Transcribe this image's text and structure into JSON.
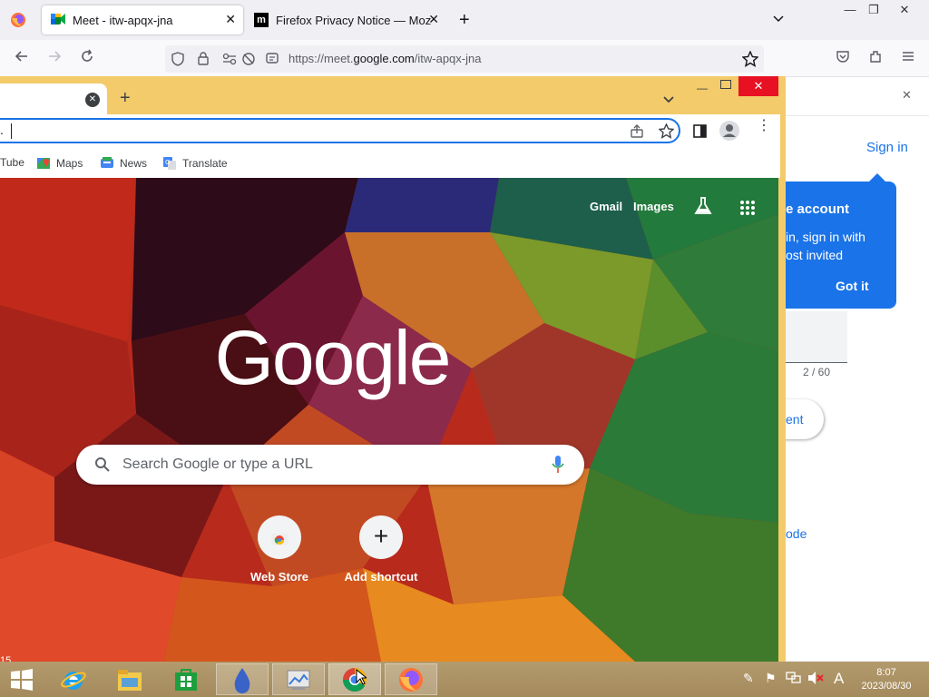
{
  "firefox": {
    "tabs": [
      {
        "title": "Meet - itw-apqx-jna",
        "active": true
      },
      {
        "title": "Firefox Privacy Notice — Mozill",
        "active": false
      }
    ],
    "url_prefix": "https://meet.",
    "url_domain": "google.com",
    "url_suffix": "/itw-apqx-jna"
  },
  "meet": {
    "sign_in": "Sign in",
    "popup_line1": "e account",
    "popup_line2": "in, sign in with",
    "popup_line3": "ost invited",
    "popup_button": "Got it",
    "counter": "2 / 60",
    "partial_button": "ent",
    "partial_link": "ode"
  },
  "chrome": {
    "omnibox_fragment": ".",
    "bookmarks": [
      {
        "label": "Tube"
      },
      {
        "label": "Maps"
      },
      {
        "label": "News"
      },
      {
        "label": "Translate"
      }
    ],
    "ntp": {
      "gmail": "Gmail",
      "images": "Images",
      "logo": "Google",
      "search_placeholder": "Search Google or type a URL",
      "shortcuts": [
        {
          "label": "Web Store"
        },
        {
          "label": "Add shortcut"
        }
      ],
      "corner_text": "15"
    }
  },
  "taskbar": {
    "time": "8:07",
    "date": "2023/08/30",
    "ime": "A"
  },
  "colors": {
    "chrome_frame": "#f3cb6a",
    "google_blue": "#1a73e8",
    "taskbar": "#a48a5c"
  }
}
